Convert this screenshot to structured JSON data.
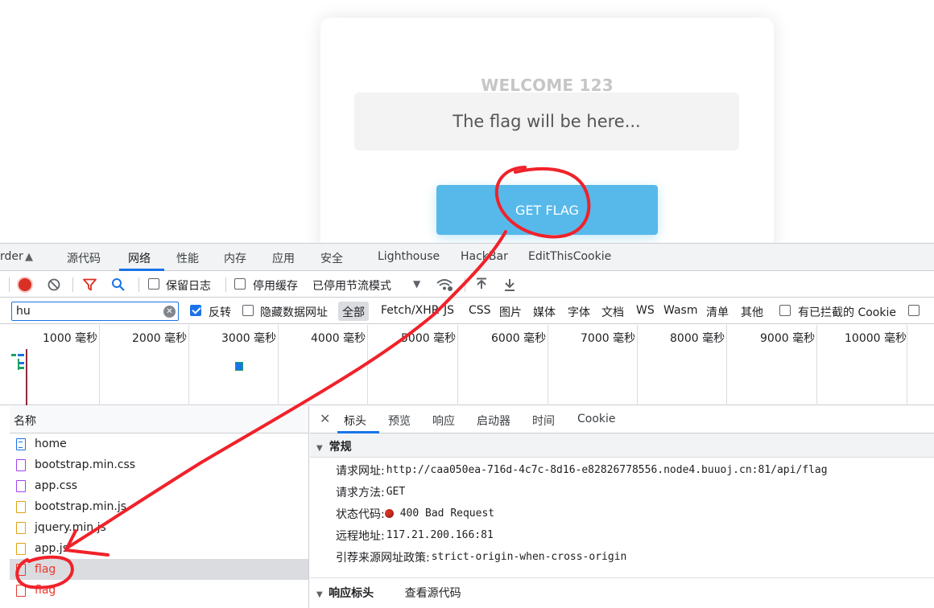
{
  "page": {
    "welcome": "WELCOME 123",
    "flag_placeholder": "The flag will be here...",
    "get_flag_button": "GET FLAG"
  },
  "devtools": {
    "tabs": [
      "rder",
      "源代码",
      "网络",
      "性能",
      "内存",
      "应用",
      "安全",
      "Lighthouse",
      "HackBar",
      "EditThisCookie"
    ],
    "active_tab": "网络",
    "toolbar": {
      "preserve_log": "保留日志",
      "disable_cache": "停用缓存",
      "throttling": "已停用节流模式"
    },
    "filter": {
      "value": "hu",
      "invert": "反转",
      "hide_data_urls": "隐藏数据网址",
      "types": [
        "全部",
        "Fetch/XHR",
        "JS",
        "CSS",
        "图片",
        "媒体",
        "字体",
        "文档",
        "WS",
        "Wasm",
        "清单",
        "其他"
      ],
      "blocked_cookies": "有已拦截的 Cookie"
    },
    "timeline_ticks": [
      "1000 毫秒",
      "2000 毫秒",
      "3000 毫秒",
      "4000 毫秒",
      "5000 毫秒",
      "6000 毫秒",
      "7000 毫秒",
      "8000 毫秒",
      "9000 毫秒",
      "10000 毫秒"
    ],
    "requests_header": "名称",
    "requests": [
      {
        "name": "home",
        "type": "doc"
      },
      {
        "name": "bootstrap.min.css",
        "type": "css"
      },
      {
        "name": "app.css",
        "type": "css"
      },
      {
        "name": "bootstrap.min.js",
        "type": "js"
      },
      {
        "name": "jquery.min.js",
        "type": "js"
      },
      {
        "name": "app.js",
        "type": "js"
      },
      {
        "name": "flag",
        "type": "err",
        "selected": true
      },
      {
        "name": "flag",
        "type": "err"
      }
    ],
    "detail_tabs": [
      "标头",
      "预览",
      "响应",
      "启动器",
      "时间",
      "Cookie"
    ],
    "general": {
      "title": "常规",
      "url_label": "请求网址:",
      "url": "http://caa050ea-716d-4c7c-8d16-e82826778556.node4.buuoj.cn:81/api/flag",
      "method_label": "请求方法:",
      "method": "GET",
      "status_label": "状态代码:",
      "status": "400 Bad Request",
      "remote_label": "远程地址:",
      "remote": "117.21.200.166:81",
      "referrer_label": "引荐来源网址政策:",
      "referrer": "strict-origin-when-cross-origin"
    },
    "response_headers": {
      "title": "响应标头",
      "view_source": "查看源代码"
    }
  },
  "colors": {
    "button": "#57b9ea",
    "accent": "#1a73e8",
    "error": "#e8392e",
    "annotation": "#f0222a"
  }
}
